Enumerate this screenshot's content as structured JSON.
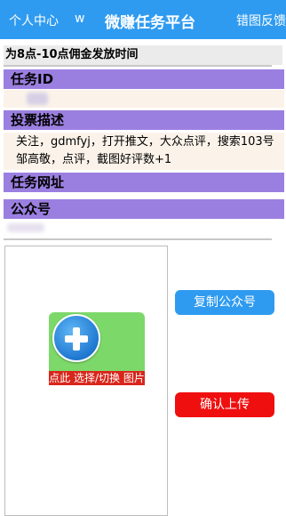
{
  "header": {
    "personal_center": "个人中心",
    "w": "w",
    "title": "微赚任务平台",
    "error_feedback": "错图反馈"
  },
  "notice": "为8点-10点佣金发放时间",
  "sections": {
    "task_id_label": "任务ID",
    "vote_desc_label": "投票描述",
    "vote_desc_line1": "关注，gdmfyj，打开推文，大众点评，搜索103号",
    "vote_desc_line2": "邹高敬，点评，截图好评数+1",
    "task_url_label": "任务网址",
    "public_account_label": "公众号"
  },
  "upload": {
    "label": "点此 选择/切换 图片"
  },
  "buttons": {
    "copy_public_account": "复制公众号",
    "confirm_upload": "确认上传"
  },
  "colors": {
    "header_bg": "#2f9bf0",
    "section_bg": "#9b7fe0",
    "copy_button": "#2f9bf0",
    "submit_button": "#f00f0f"
  }
}
